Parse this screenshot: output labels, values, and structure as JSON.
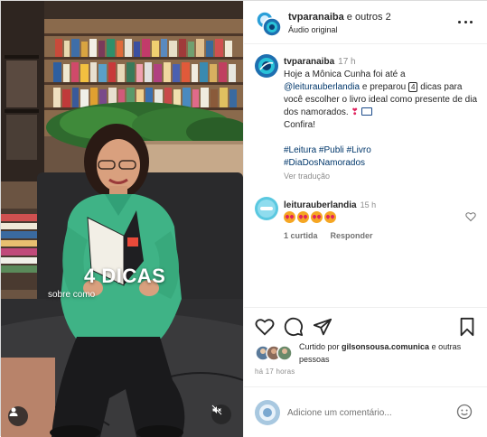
{
  "header": {
    "username": "tvparanaiba",
    "title_rest": " e outros 2",
    "audio": "Áudio original",
    "more_icon": "more-horizontal-icon"
  },
  "media": {
    "overlay_big": "4 DICAS",
    "overlay_small": "sobre como"
  },
  "caption": {
    "username": "tvparanaiba",
    "time": "17 h",
    "line1": "Hoje a Mônica Cunha foi até a",
    "mention": "@leiturauberlandia",
    "line2a": " e preparou ",
    "number_box": "4",
    "line2b": " dicas para você escolher o livro ideal como presente de dia dos namorados.",
    "line3": "Confira!",
    "hashtags_line1": [
      "#Leitura",
      "#Publi",
      "#Livro"
    ],
    "hashtags_line2": [
      "#DiaDosNamorados"
    ],
    "see_translation": "Ver tradução"
  },
  "comment": {
    "username": "leiturauberlandia",
    "time": "15 h",
    "likes": "1 curtida",
    "reply": "Responder"
  },
  "likes": {
    "prefix": "Curtido por ",
    "user": "gilsonsousa.comunica",
    "middle": " e ",
    "others": "outras pessoas"
  },
  "time_ago": "há 17 horas",
  "add_comment": {
    "placeholder": "Adicione um comentário..."
  },
  "colors": {
    "accent_link": "#00376b",
    "muted": "#8e8e8e",
    "heart_red": "#e0245e"
  }
}
